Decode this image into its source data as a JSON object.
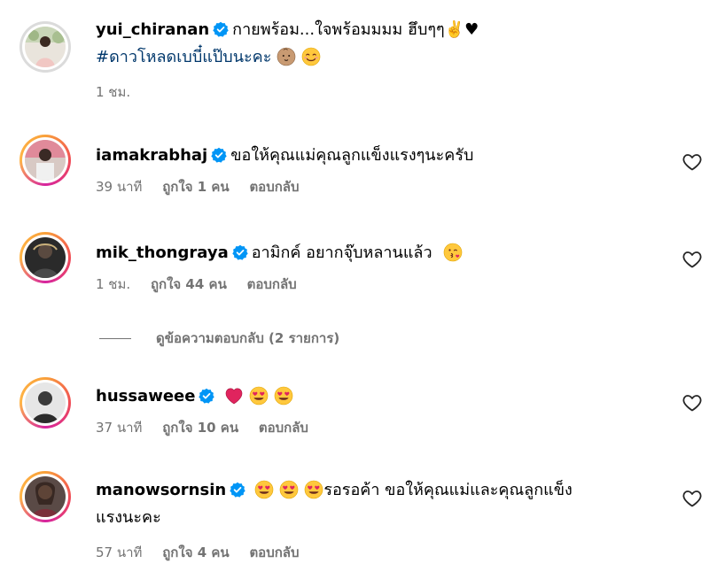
{
  "comments": [
    {
      "username": "yui_chiranan",
      "text_line1": "กายพร้อม...ใจพร้อมมมม ฮึบๆๆ✌️♥",
      "hashtag": "#ดาวโหลดเบบี๋แป๊บนะคะ",
      "time": "1 ชม.",
      "ring": "gradient"
    },
    {
      "username": "iamakrabhaj",
      "text": "ขอให้คุณแม่คุณลูกแข็งแรงๆนะครับ",
      "time": "39 นาที",
      "likes": "ถูกใจ 1 คน",
      "reply": "ตอบกลับ"
    },
    {
      "username": "mik_thongraya",
      "text": "อามิกค์ อยากจุ๊บหลานแล้ว",
      "time": "1 ชม.",
      "likes": "ถูกใจ 44 คน",
      "reply": "ตอบกลับ"
    },
    {
      "username": "hussaweee",
      "text": "",
      "time": "37 นาที",
      "likes": "ถูกใจ 10 คน",
      "reply": "ตอบกลับ"
    },
    {
      "username": "manowsornsin",
      "text_line1": "รอรอค้า ขอให้คุณแม่และคุณลูกแข็ง",
      "text_line2": "แรงนะคะ",
      "time": "57 นาที",
      "likes": "ถูกใจ 4 คน",
      "reply": "ตอบกลับ"
    }
  ],
  "view_replies_label": "ดูข้อความตอบกลับ (2 รายการ)",
  "colors": {
    "verified": "#0095f6",
    "meta_text": "#737373",
    "hashtag": "#00376b",
    "emoji_heart": "#e0245e"
  }
}
